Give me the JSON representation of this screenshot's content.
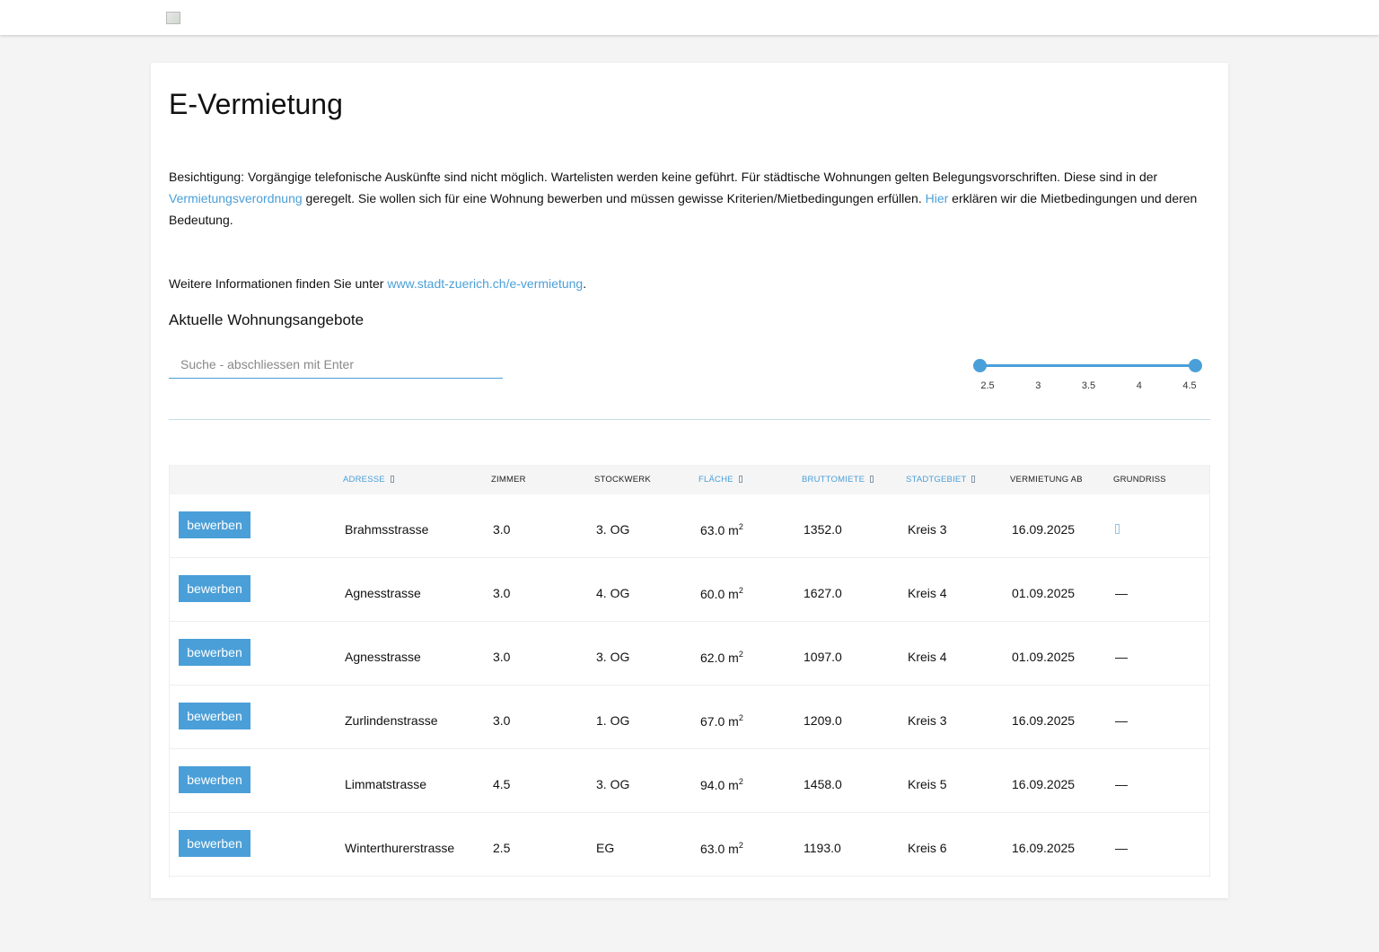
{
  "header": {
    "logo_alt": ""
  },
  "page": {
    "title": "E-Vermietung",
    "intro_part1": "Besichtigung: Vorgängige telefonische Auskünfte sind nicht möglich. Wartelisten werden keine geführt. Für städtische Wohnungen gelten Belegungsvorschriften. Diese sind in der ",
    "intro_link1": "Vermietungsverordnung",
    "intro_part2": " geregelt. Sie wollen sich für eine Wohnung bewerben und müssen gewisse Kriterien/Mietbedingungen erfüllen. ",
    "intro_link2": "Hier",
    "intro_part3": " erklären wir die Mietbedingungen und deren Bedeutung.",
    "more_prefix": "Weitere Informationen finden Sie unter ",
    "more_link": "www.stadt-zuerich.ch/e-vermietung",
    "more_suffix": ".",
    "subtitle": "Aktuelle Wohnungsangebote"
  },
  "search": {
    "placeholder": "Suche - abschliessen mit Enter",
    "value": ""
  },
  "rooms_slider": {
    "ticks": [
      "2.5",
      "3",
      "3.5",
      "4",
      "4.5"
    ],
    "min": 2.5,
    "max": 4.5,
    "selected_min": 2.5,
    "selected_max": 4.5
  },
  "table": {
    "headers": {
      "adresse": "Adresse",
      "zimmer": "Zimmer",
      "stockwerk": "Stockwerk",
      "flaeche": "Fläche",
      "bruttomiete": "Bruttomiete",
      "stadtgebiet": "Stadtgebiet",
      "vermietung_ab": "Vermietung ab",
      "grundriss": "Grundriss"
    },
    "apply_label": "bewerben",
    "area_unit": "m",
    "area_unit_sup": "2",
    "no_plan": "—",
    "rows": [
      {
        "adresse": "Brahmsstrasse",
        "zimmer": "3.0",
        "stockwerk": "3. OG",
        "flaeche": "63.0",
        "bruttomiete": "1352.0",
        "stadtgebiet": "Kreis 3",
        "vermietung_ab": "16.09.2025",
        "grundriss": "file-icon"
      },
      {
        "adresse": "Agnesstrasse",
        "zimmer": "3.0",
        "stockwerk": "4. OG",
        "flaeche": "60.0",
        "bruttomiete": "1627.0",
        "stadtgebiet": "Kreis 4",
        "vermietung_ab": "01.09.2025",
        "grundriss": "—"
      },
      {
        "adresse": "Agnesstrasse",
        "zimmer": "3.0",
        "stockwerk": "3. OG",
        "flaeche": "62.0",
        "bruttomiete": "1097.0",
        "stadtgebiet": "Kreis 4",
        "vermietung_ab": "01.09.2025",
        "grundriss": "—"
      },
      {
        "adresse": "Zurlindenstrasse",
        "zimmer": "3.0",
        "stockwerk": "1. OG",
        "flaeche": "67.0",
        "bruttomiete": "1209.0",
        "stadtgebiet": "Kreis 3",
        "vermietung_ab": "16.09.2025",
        "grundriss": "—"
      },
      {
        "adresse": "Limmatstrasse",
        "zimmer": "4.5",
        "stockwerk": "3. OG",
        "flaeche": "94.0",
        "bruttomiete": "1458.0",
        "stadtgebiet": "Kreis 5",
        "vermietung_ab": "16.09.2025",
        "grundriss": "—"
      },
      {
        "adresse": "Winterthurerstrasse",
        "zimmer": "2.5",
        "stockwerk": "EG",
        "flaeche": "63.0",
        "bruttomiete": "1193.0",
        "stadtgebiet": "Kreis 6",
        "vermietung_ab": "16.09.2025",
        "grundriss": "—"
      }
    ]
  },
  "colors": {
    "accent": "#4a9fd8",
    "background": "#f4f4f4"
  }
}
